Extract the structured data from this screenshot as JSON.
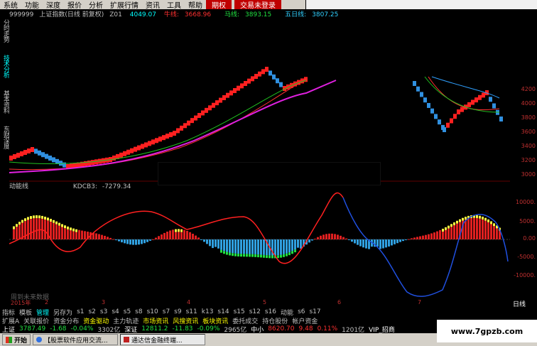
{
  "menu": {
    "items": [
      "系统",
      "功能",
      "深度",
      "报价",
      "分析",
      "扩展行情",
      "资讯",
      "工具",
      "帮助"
    ],
    "active": "期权",
    "login": "交易未登录"
  },
  "side_tabs": [
    "分时走势",
    "技术分析",
    "基本资料",
    "东财深度"
  ],
  "chart_header": {
    "code": "999999",
    "name": "上证指数(日线 前复权)",
    "z": "Z01",
    "value1": "4049.07",
    "ma_a_label": "牛线:",
    "ma_a_value": "3668.96",
    "ma_b_label": "马线:",
    "ma_b_value": "3893.15",
    "ma_c_label": "五日线:",
    "ma_c_value": "3807.25"
  },
  "indicator": {
    "name": "动能线",
    "field": "KDCB3:",
    "value": "-7279.34",
    "future_text": "周到未来数据"
  },
  "price_axis": [
    "4200",
    "4000",
    "3800",
    "3600",
    "3400",
    "3200",
    "3000"
  ],
  "ind_axis": [
    "10000.",
    "5000.",
    "0.00",
    "-5000.",
    "-10000."
  ],
  "months": {
    "year": "2015年",
    "labels": [
      "2",
      "3",
      "4",
      "5",
      "6",
      "7"
    ]
  },
  "day_label": "日线",
  "bottom_tabs": [
    "指标",
    "模板",
    "管理",
    "另存为",
    "s1",
    "s2",
    "s3",
    "s4",
    "s5",
    "s8",
    "s10",
    "s7",
    "s9",
    "s11",
    "k13",
    "s14",
    "s15",
    "s12",
    "s16",
    "动能",
    "s6",
    "s17"
  ],
  "bottom_tabs_selected": "管理",
  "sector_labels": [
    "扩展A",
    "关联报价",
    "资金分布",
    "资金驱动",
    "主力轨迹",
    "市场资讯",
    "风搜资讯",
    "板块资讯",
    "委托成交",
    "持仓股份",
    "帐户资金"
  ],
  "sector_highlighted": [
    "资金驱动",
    "市场资讯",
    "风搜资讯",
    "板块资讯"
  ],
  "ticker": {
    "sh_label": "上证",
    "sh_value": "3787.49",
    "sh_change": "-1.68",
    "sh_pct": "-0.04%",
    "sh_amount": "3302亿",
    "sz_label": "深证",
    "sz_value": "12811.2",
    "sz_change": "-11.83",
    "sz_pct": "-0.09%",
    "sz_amount": "2965亿",
    "zx_label": "中小",
    "zx_value": "8620.70",
    "zx_change": "9.48",
    "zx_pct": "0.11%",
    "zx_amount": "1201亿",
    "vip": "VIP_招商"
  },
  "taskbar": {
    "start": "开始",
    "tasks": [
      "【股票软件应用交流...",
      "通达信金融终端..."
    ]
  },
  "watermark": "www.7gpzb.com",
  "colors": {
    "up": "#ff2020",
    "down": "#3090e0",
    "ma1": "#ff3030",
    "ma2": "#20c020",
    "ma3": "#e020e0",
    "ma4": "#30a0ff",
    "yellow": "#ffff00",
    "green": "#20e040"
  }
}
